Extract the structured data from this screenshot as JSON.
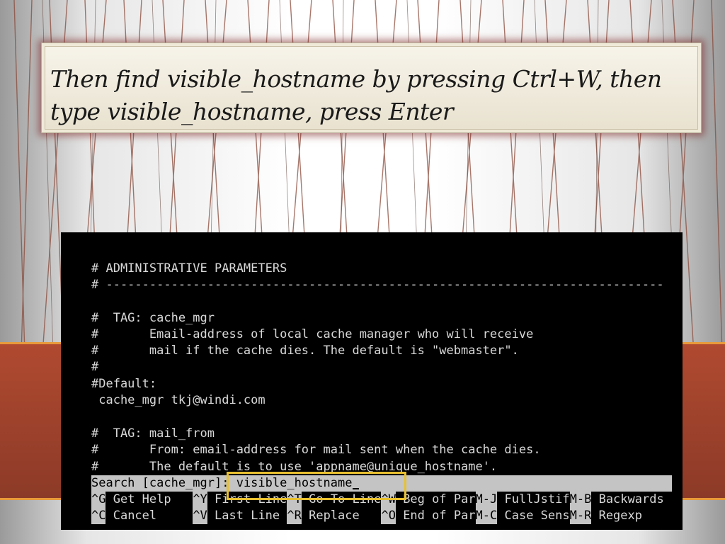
{
  "title": "Then find visible_hostname by pressing Ctrl+W, then type visible_hostname, press Enter",
  "terminal": {
    "lines": [
      "# ADMINISTRATIVE PARAMETERS",
      "# -----------------------------------------------------------------------------",
      "",
      "#  TAG: cache_mgr",
      "#       Email-address of local cache manager who will receive",
      "#       mail if the cache dies. The default is \"webmaster\".",
      "#",
      "#Default:",
      " cache_mgr tkj@windi.com",
      "",
      "#  TAG: mail_from",
      "#       From: email-address for mail sent when the cache dies.",
      "#       The default is to use 'appname@unique_hostname'."
    ],
    "search_prompt": "Search [cache_mgr]: ",
    "search_value": "visible_hostname",
    "shortcuts_row1": [
      {
        "key": "^G",
        "label": " Get Help   "
      },
      {
        "key": "^Y",
        "label": " First Line"
      },
      {
        "key": "^T",
        "label": " Go To Line"
      },
      {
        "key": "^W",
        "label": " Beg of Par"
      },
      {
        "key": "M-J",
        "label": " FullJstif"
      },
      {
        "key": "M-B",
        "label": " Backwards"
      }
    ],
    "shortcuts_row2": [
      {
        "key": "^C",
        "label": " Cancel     "
      },
      {
        "key": "^V",
        "label": " Last Line "
      },
      {
        "key": "^R",
        "label": " Replace   "
      },
      {
        "key": "^O",
        "label": " End of Par"
      },
      {
        "key": "M-C",
        "label": " Case Sens"
      },
      {
        "key": "M-R",
        "label": " Regexp"
      }
    ]
  },
  "colors": {
    "highlight": "#e8c030",
    "band": "#8c3a28"
  }
}
